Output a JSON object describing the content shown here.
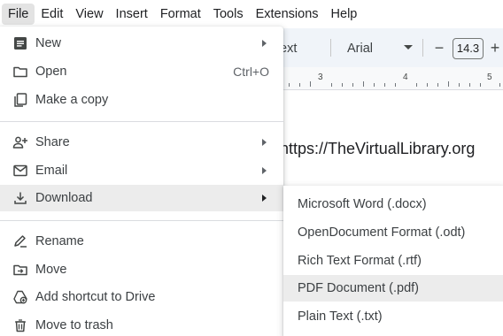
{
  "menubar": {
    "items": [
      {
        "label": "File"
      },
      {
        "label": "Edit"
      },
      {
        "label": "View"
      },
      {
        "label": "Insert"
      },
      {
        "label": "Format"
      },
      {
        "label": "Tools"
      },
      {
        "label": "Extensions"
      },
      {
        "label": "Help"
      }
    ]
  },
  "toolbar": {
    "style_label": "ext",
    "font_name": "Arial",
    "minus_label": "−",
    "font_size": "14.3",
    "plus_label": "+"
  },
  "ruler": {
    "numbers": [
      "3",
      "4",
      "5"
    ]
  },
  "document": {
    "text": "https://TheVirtualLibrary.org"
  },
  "file_menu": {
    "items": [
      {
        "label": "New",
        "icon": "doc-icon",
        "has_submenu": true
      },
      {
        "label": "Open",
        "icon": "folder-icon",
        "shortcut": "Ctrl+O"
      },
      {
        "label": "Make a copy",
        "icon": "copy-icon"
      },
      {
        "label": "Share",
        "icon": "person-add-icon",
        "has_submenu": true
      },
      {
        "label": "Email",
        "icon": "mail-icon",
        "has_submenu": true
      },
      {
        "label": "Download",
        "icon": "download-icon",
        "has_submenu": true,
        "highlighted": true
      },
      {
        "label": "Rename",
        "icon": "rename-icon"
      },
      {
        "label": "Move",
        "icon": "move-folder-icon"
      },
      {
        "label": "Add shortcut to Drive",
        "icon": "drive-shortcut-icon"
      },
      {
        "label": "Move to trash",
        "icon": "trash-icon"
      }
    ]
  },
  "download_submenu": {
    "items": [
      {
        "label": "Microsoft Word (.docx)"
      },
      {
        "label": "OpenDocument Format (.odt)"
      },
      {
        "label": "Rich Text Format (.rtf)"
      },
      {
        "label": "PDF Document (.pdf)",
        "highlighted": true
      },
      {
        "label": "Plain Text (.txt)"
      }
    ]
  },
  "colors": {
    "menu_hover": "#ececec",
    "menubar_active": "#e3e3e3",
    "toolbar_bg": "#f0f4f9",
    "text": "#3c4043"
  }
}
